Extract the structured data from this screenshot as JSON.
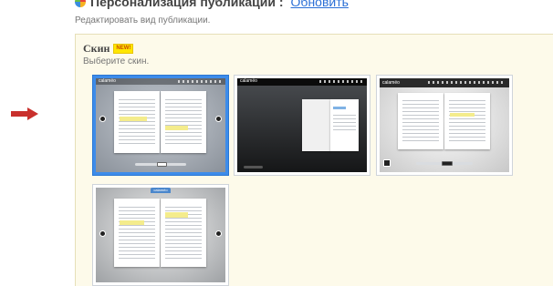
{
  "header": {
    "title": "Персонализация публикации :",
    "update_link": "Обновить",
    "subtitle": "Редактировать вид публикации."
  },
  "skin_section": {
    "title": "Скин",
    "badge": "NEW!",
    "subtitle": "Выберите скин."
  },
  "skins": [
    {
      "id": "skin-1",
      "brand": "calaméo",
      "selected": true
    },
    {
      "id": "skin-2",
      "brand": "calaméo",
      "selected": false
    },
    {
      "id": "skin-3",
      "brand": "calaméo",
      "selected": false
    },
    {
      "id": "skin-4",
      "brand": "calaméo",
      "selected": false
    }
  ],
  "colors": {
    "accent": "#3d8cea",
    "arrow": "#c9302c",
    "panel_bg": "#fdfaea",
    "link": "#2a6fd6"
  },
  "icons": {
    "pointer": "right-arrow-icon",
    "logo": "calameo-logo-icon"
  }
}
